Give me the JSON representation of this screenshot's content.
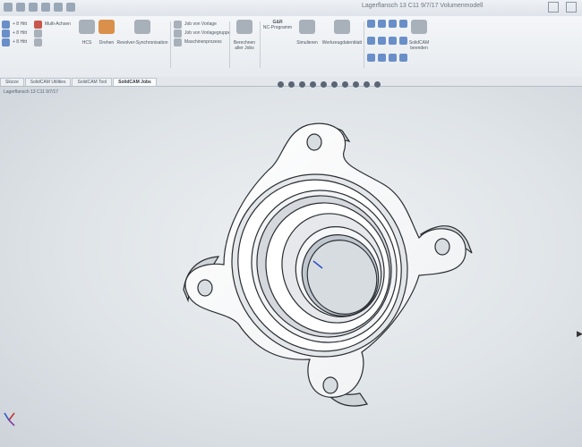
{
  "titlebar": {
    "title": "Lagerflansch 13 C11 9/7/17 Volumenmodell"
  },
  "ribbon": {
    "left_items": [
      "+ 8 Hitt",
      "+ 8 Hitt",
      "+ 8 Hitt"
    ],
    "multi_label": "Multi-Achsen",
    "hcs_label": "HCS",
    "drehen_label": "Drehen",
    "kopplung_label": "Revolver-Synchronisation",
    "job_items": [
      "Job von Vorlage",
      "Job von Vorlagegruppe",
      "Maschinenprozess"
    ],
    "berechnen_label": "Berechnen aller Jobs",
    "gdr_label": "G&R",
    "nc_label": "NC-Programm",
    "simulieren_label": "Simulieren",
    "werkzeug_label": "Werkzeugdatenblatt",
    "end_label": "SolidCAM beenden"
  },
  "tabs": [
    {
      "label": "Skizze"
    },
    {
      "label": "SolidCAM Utilities"
    },
    {
      "label": "SolidCAM Tool"
    },
    {
      "label": "SolidCAM Jobs",
      "active": true
    }
  ],
  "document": {
    "name": "Lagerflansch 13 C11 9/7/17"
  },
  "colors": {
    "part_face": "#ffffff",
    "part_edge": "#2a2e33",
    "viewport_bg": "#dfe4e8"
  }
}
